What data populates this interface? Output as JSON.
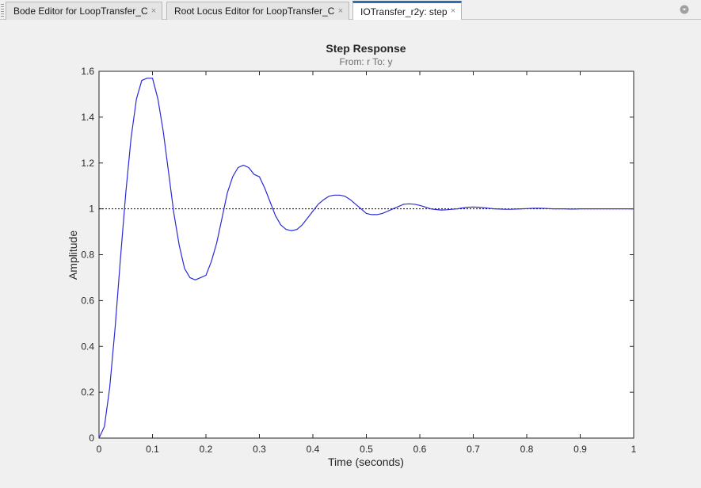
{
  "tabs": [
    {
      "label": "Bode Editor for LoopTransfer_C",
      "close": "×",
      "active": false
    },
    {
      "label": "Root Locus Editor for LoopTransfer_C",
      "close": "×",
      "active": false
    },
    {
      "label": "IOTransfer_r2y: step",
      "close": "×",
      "active": true
    }
  ],
  "menu_icon": "circle-chevron-down-icon",
  "chart_data": {
    "type": "line",
    "title": "Step Response",
    "subtitle": "From: r  To: y",
    "xlabel": "Time (seconds)",
    "ylabel": "Amplitude",
    "xlim": [
      0,
      1
    ],
    "ylim": [
      0,
      1.6
    ],
    "xticks": [
      "0",
      "0.1",
      "0.2",
      "0.3",
      "0.4",
      "0.5",
      "0.6",
      "0.7",
      "0.8",
      "0.9",
      "1"
    ],
    "yticks": [
      "0",
      "0.2",
      "0.4",
      "0.6",
      "0.8",
      "1",
      "1.2",
      "1.4",
      "1.6"
    ],
    "grid": false,
    "series": [
      {
        "color": "#2a2ad8",
        "x": [
          0,
          0.01,
          0.02,
          0.03,
          0.04,
          0.05,
          0.06,
          0.07,
          0.08,
          0.09,
          0.1,
          0.11,
          0.12,
          0.13,
          0.14,
          0.15,
          0.16,
          0.17,
          0.18,
          0.19,
          0.2,
          0.21,
          0.22,
          0.23,
          0.24,
          0.25,
          0.26,
          0.27,
          0.28,
          0.29,
          0.3,
          0.31,
          0.32,
          0.33,
          0.34,
          0.35,
          0.36,
          0.37,
          0.38,
          0.39,
          0.4,
          0.41,
          0.42,
          0.43,
          0.44,
          0.45,
          0.46,
          0.47,
          0.48,
          0.49,
          0.5,
          0.51,
          0.52,
          0.53,
          0.54,
          0.55,
          0.56,
          0.57,
          0.58,
          0.59,
          0.6,
          0.61,
          0.62,
          0.63,
          0.64,
          0.65,
          0.66,
          0.67,
          0.68,
          0.69,
          0.7,
          0.71,
          0.72,
          0.73,
          0.74,
          0.75,
          0.76,
          0.77,
          0.78,
          0.79,
          0.8,
          0.81,
          0.82,
          0.83,
          0.84,
          0.85,
          0.86,
          0.87,
          0.88,
          0.89,
          0.9,
          0.91,
          0.92,
          0.93,
          0.94,
          0.95,
          0.96,
          0.97,
          0.98,
          0.99,
          1.0
        ],
        "y": [
          0,
          0.05,
          0.22,
          0.48,
          0.78,
          1.07,
          1.31,
          1.48,
          1.56,
          1.57,
          1.57,
          1.48,
          1.34,
          1.16,
          0.98,
          0.84,
          0.74,
          0.7,
          0.69,
          0.7,
          0.71,
          0.77,
          0.85,
          0.96,
          1.07,
          1.14,
          1.18,
          1.19,
          1.18,
          1.15,
          1.14,
          1.09,
          1.03,
          0.97,
          0.93,
          0.91,
          0.905,
          0.91,
          0.93,
          0.96,
          0.99,
          1.02,
          1.04,
          1.055,
          1.06,
          1.06,
          1.055,
          1.04,
          1.02,
          1.0,
          0.98,
          0.975,
          0.975,
          0.98,
          0.99,
          1.0,
          1.01,
          1.02,
          1.022,
          1.02,
          1.015,
          1.008,
          1.0,
          0.997,
          0.995,
          0.996,
          0.998,
          1.0,
          1.004,
          1.007,
          1.008,
          1.007,
          1.005,
          1.002,
          1.0,
          0.999,
          0.998,
          0.998,
          0.999,
          1.0,
          1.001,
          1.002,
          1.003,
          1.002,
          1.001,
          1.0,
          1.0,
          1.0,
          0.999,
          0.999,
          1.0,
          1.0,
          1.0,
          1.0,
          1.0,
          1.0,
          1.0,
          1.0,
          1.0,
          1.0,
          1.0
        ]
      }
    ],
    "reference_line": {
      "y": 1,
      "style": "dotted",
      "color": "#000000"
    }
  }
}
